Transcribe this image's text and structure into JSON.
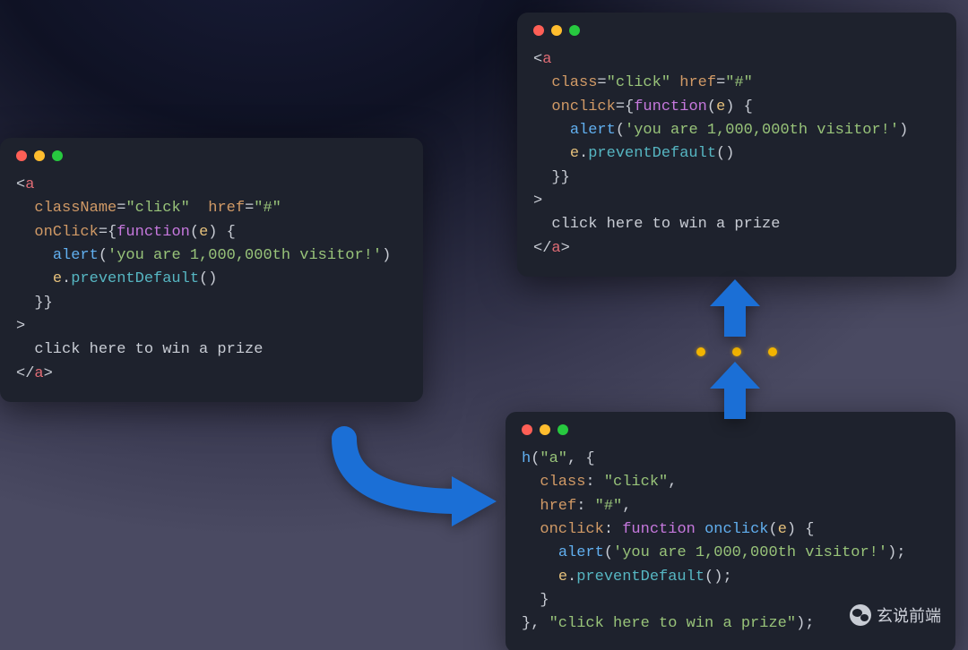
{
  "colors": {
    "tag": "#e06c75",
    "attr": "#d19a66",
    "string": "#98c379",
    "keyword": "#c678dd",
    "func": "#61afef",
    "var": "#e5c07b",
    "method": "#56b6c2",
    "arrow": "#1b6fd6"
  },
  "badge": {
    "text": "玄说前端"
  },
  "code_left": {
    "raw": "<a\n  className=\"click\"  href=\"#\"\n  onClick={function(e) {\n    alert('you are 1,000,000th visitor!')\n    e.preventDefault()\n  }}\n>\n  click here to win a prize\n</a>",
    "tokens": [
      [
        [
          "p",
          "<"
        ],
        [
          "tg",
          "a"
        ]
      ],
      [
        [
          "p",
          "  "
        ],
        [
          "at",
          "className"
        ],
        [
          "p",
          "="
        ],
        [
          "st",
          "\"click\""
        ],
        [
          "p",
          "  "
        ],
        [
          "at",
          "href"
        ],
        [
          "p",
          "="
        ],
        [
          "st",
          "\"#\""
        ]
      ],
      [
        [
          "p",
          "  "
        ],
        [
          "at",
          "onClick"
        ],
        [
          "p",
          "={"
        ],
        [
          "kw",
          "function"
        ],
        [
          "p",
          "("
        ],
        [
          "va",
          "e"
        ],
        [
          "p",
          ") {"
        ]
      ],
      [
        [
          "p",
          "    "
        ],
        [
          "fn",
          "alert"
        ],
        [
          "p",
          "("
        ],
        [
          "st",
          "'you are 1,000,000th visitor!'"
        ],
        [
          "p",
          ")"
        ]
      ],
      [
        [
          "p",
          "    "
        ],
        [
          "va",
          "e"
        ],
        [
          "p",
          "."
        ],
        [
          "mt",
          "preventDefault"
        ],
        [
          "p",
          "()"
        ]
      ],
      [
        [
          "p",
          "  }}"
        ]
      ],
      [
        [
          "p",
          ">"
        ]
      ],
      [
        [
          "p",
          "  click here to win a prize"
        ]
      ],
      [
        [
          "p",
          "</"
        ],
        [
          "tg",
          "a"
        ],
        [
          "p",
          ">"
        ]
      ]
    ]
  },
  "code_top": {
    "raw": "<a\n  class=\"click\" href=\"#\"\n  onclick={function(e) {\n    alert('you are 1,000,000th visitor!')\n    e.preventDefault()\n  }}\n>\n  click here to win a prize\n</a>",
    "tokens": [
      [
        [
          "p",
          "<"
        ],
        [
          "tg",
          "a"
        ]
      ],
      [
        [
          "p",
          "  "
        ],
        [
          "at",
          "class"
        ],
        [
          "p",
          "="
        ],
        [
          "st",
          "\"click\""
        ],
        [
          "p",
          " "
        ],
        [
          "at",
          "href"
        ],
        [
          "p",
          "="
        ],
        [
          "st",
          "\"#\""
        ]
      ],
      [
        [
          "p",
          "  "
        ],
        [
          "at",
          "onclick"
        ],
        [
          "p",
          "={"
        ],
        [
          "kw",
          "function"
        ],
        [
          "p",
          "("
        ],
        [
          "va",
          "e"
        ],
        [
          "p",
          ") {"
        ]
      ],
      [
        [
          "p",
          "    "
        ],
        [
          "fn",
          "alert"
        ],
        [
          "p",
          "("
        ],
        [
          "st",
          "'you are 1,000,000th visitor!'"
        ],
        [
          "p",
          ")"
        ]
      ],
      [
        [
          "p",
          "    "
        ],
        [
          "va",
          "e"
        ],
        [
          "p",
          "."
        ],
        [
          "mt",
          "preventDefault"
        ],
        [
          "p",
          "()"
        ]
      ],
      [
        [
          "p",
          "  }}"
        ]
      ],
      [
        [
          "p",
          ">"
        ]
      ],
      [
        [
          "p",
          "  click here to win a prize"
        ]
      ],
      [
        [
          "p",
          "</"
        ],
        [
          "tg",
          "a"
        ],
        [
          "p",
          ">"
        ]
      ]
    ]
  },
  "code_bottom": {
    "raw": "h(\"a\", {\n  class: \"click\",\n  href: \"#\",\n  onclick: function onclick(e) {\n    alert('you are 1,000,000th visitor!');\n    e.preventDefault();\n  }\n}, \"click here to win a prize\");",
    "tokens": [
      [
        [
          "fn",
          "h"
        ],
        [
          "p",
          "("
        ],
        [
          "st",
          "\"a\""
        ],
        [
          "p",
          ", {"
        ]
      ],
      [
        [
          "p",
          "  "
        ],
        [
          "at",
          "class"
        ],
        [
          "p",
          ": "
        ],
        [
          "st",
          "\"click\""
        ],
        [
          "p",
          ","
        ]
      ],
      [
        [
          "p",
          "  "
        ],
        [
          "at",
          "href"
        ],
        [
          "p",
          ": "
        ],
        [
          "st",
          "\"#\""
        ],
        [
          "p",
          ","
        ]
      ],
      [
        [
          "p",
          "  "
        ],
        [
          "at",
          "onclick"
        ],
        [
          "p",
          ": "
        ],
        [
          "kw",
          "function"
        ],
        [
          "p",
          " "
        ],
        [
          "fn",
          "onclick"
        ],
        [
          "p",
          "("
        ],
        [
          "va",
          "e"
        ],
        [
          "p",
          ") {"
        ]
      ],
      [
        [
          "p",
          "    "
        ],
        [
          "fn",
          "alert"
        ],
        [
          "p",
          "("
        ],
        [
          "st",
          "'you are 1,000,000th visitor!'"
        ],
        [
          "p",
          ");"
        ]
      ],
      [
        [
          "p",
          "    "
        ],
        [
          "va",
          "e"
        ],
        [
          "p",
          "."
        ],
        [
          "mt",
          "preventDefault"
        ],
        [
          "p",
          "();"
        ]
      ],
      [
        [
          "p",
          "  }"
        ]
      ],
      [
        [
          "p",
          "}, "
        ],
        [
          "st",
          "\"click here to win a prize\""
        ],
        [
          "p",
          ");"
        ]
      ]
    ]
  }
}
